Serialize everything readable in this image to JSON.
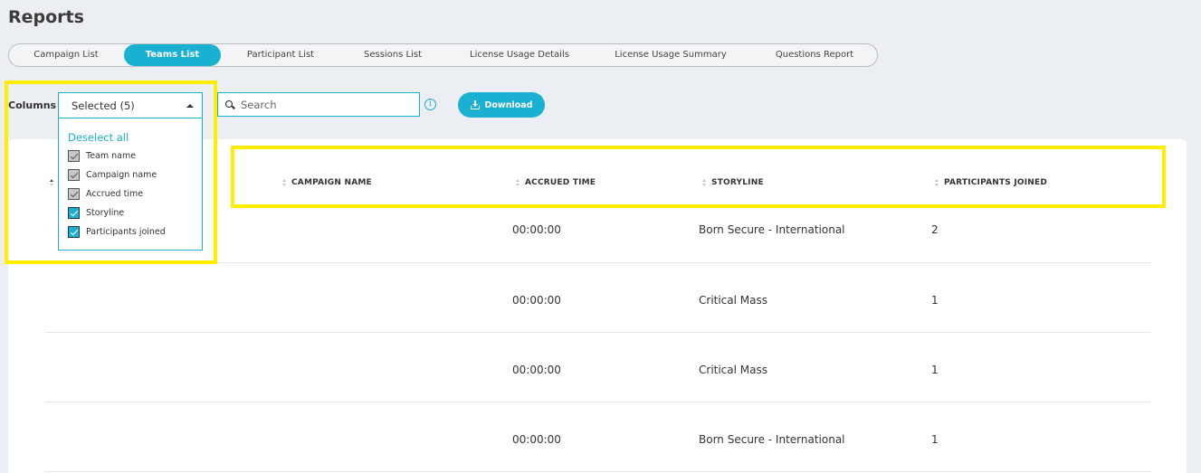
{
  "page": {
    "title": "Reports"
  },
  "tabs": [
    {
      "label": "Campaign List",
      "active": false
    },
    {
      "label": "Teams List",
      "active": true
    },
    {
      "label": "Participant List",
      "active": false
    },
    {
      "label": "Sessions List",
      "active": false
    },
    {
      "label": "License Usage Details",
      "active": false
    },
    {
      "label": "License Usage Summary",
      "active": false
    },
    {
      "label": "Questions Report",
      "active": false
    }
  ],
  "toolbar": {
    "columns_label": "Columns",
    "columns_selected": "Selected (5)",
    "search_placeholder": "Search",
    "info_symbol": "i",
    "download_label": "Download"
  },
  "columns_dropdown": {
    "deselect_label": "Deselect all",
    "options": [
      {
        "label": "Team name",
        "checked": true,
        "locked": true
      },
      {
        "label": "Campaign name",
        "checked": true,
        "locked": true
      },
      {
        "label": "Accrued time",
        "checked": true,
        "locked": true
      },
      {
        "label": "Storyline",
        "checked": true,
        "locked": false
      },
      {
        "label": "Participants joined",
        "checked": true,
        "locked": false
      }
    ]
  },
  "table": {
    "headers": [
      "CAMPAIGN NAME",
      "ACCRUED TIME",
      "STORYLINE",
      "PARTICIPANTS JOINED"
    ],
    "rows": [
      {
        "accrued_time": "00:00:00",
        "storyline": "Born Secure - International",
        "participants": "2"
      },
      {
        "accrued_time": "00:00:00",
        "storyline": "Critical Mass",
        "participants": "1"
      },
      {
        "accrued_time": "00:00:00",
        "storyline": "Critical Mass",
        "participants": "1"
      },
      {
        "accrued_time": "00:00:00",
        "storyline": "Born Secure - International",
        "participants": "1"
      }
    ]
  },
  "colors": {
    "accent": "#1ab0d1",
    "highlight": "#ffee00",
    "background": "#ebeef2"
  }
}
